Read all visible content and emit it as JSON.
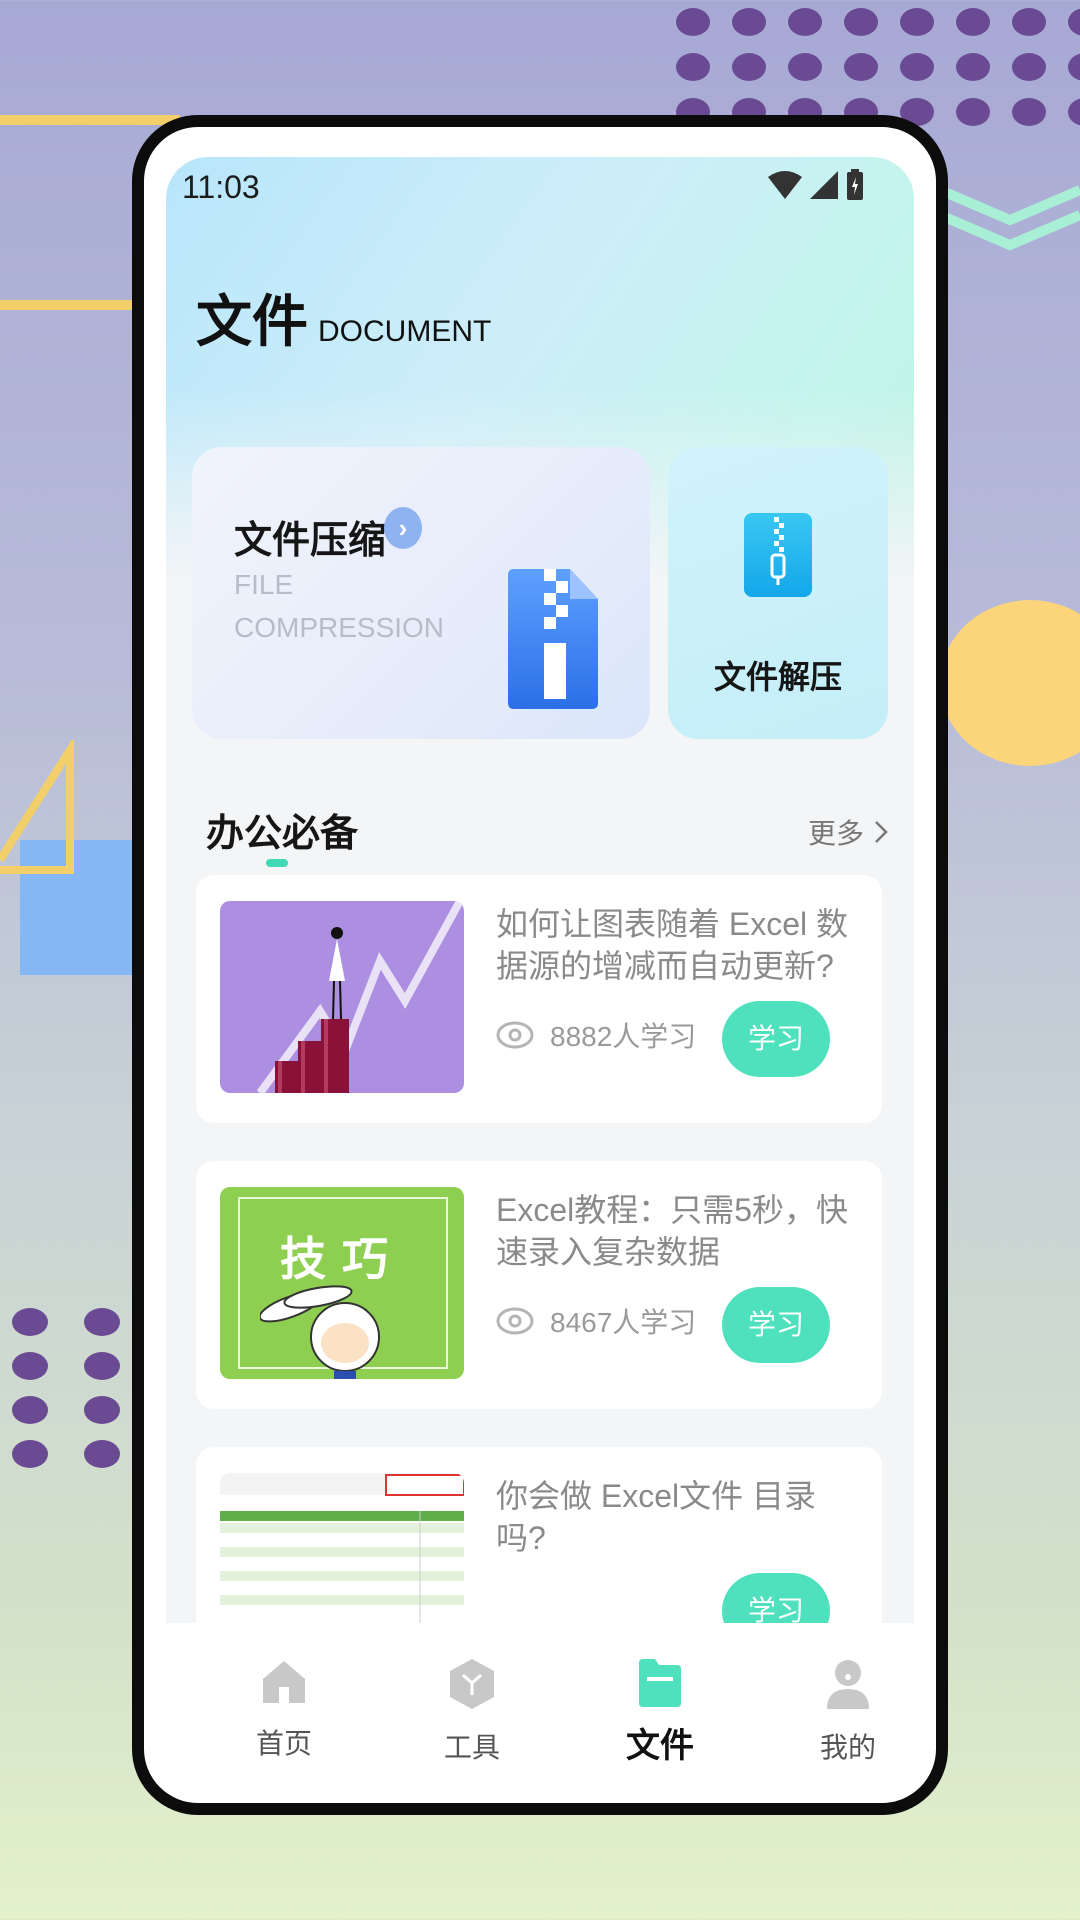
{
  "status": {
    "time": "11:03"
  },
  "header": {
    "title_cn": "文件",
    "title_en": "DOCUMENT"
  },
  "cards": {
    "compress": {
      "title": "文件压缩",
      "sub1": "FILE",
      "sub2": "COMPRESSION"
    },
    "decompress": {
      "title": "文件解压"
    }
  },
  "section": {
    "title": "办公必备",
    "more": "更多"
  },
  "articles": [
    {
      "title": "如何让图表随着 Excel 数据源的增减而自动更新?",
      "views": "8882人学习",
      "button": "学习"
    },
    {
      "title": "Excel教程：只需5秒，快速录入复杂数据",
      "views": "8467人学习",
      "button": "学习",
      "thumb_text": "技巧"
    },
    {
      "title": "你会做 Excel文件 目录吗?",
      "button": "学习"
    }
  ],
  "tabs": [
    {
      "label": "首页",
      "icon": "home-icon"
    },
    {
      "label": "工具",
      "icon": "tool-icon"
    },
    {
      "label": "文件",
      "icon": "folder-icon",
      "active": true
    },
    {
      "label": "我的",
      "icon": "user-icon"
    }
  ],
  "colors": {
    "accent": "#4fe0bd",
    "compress_blue": "#3b7ff0"
  }
}
